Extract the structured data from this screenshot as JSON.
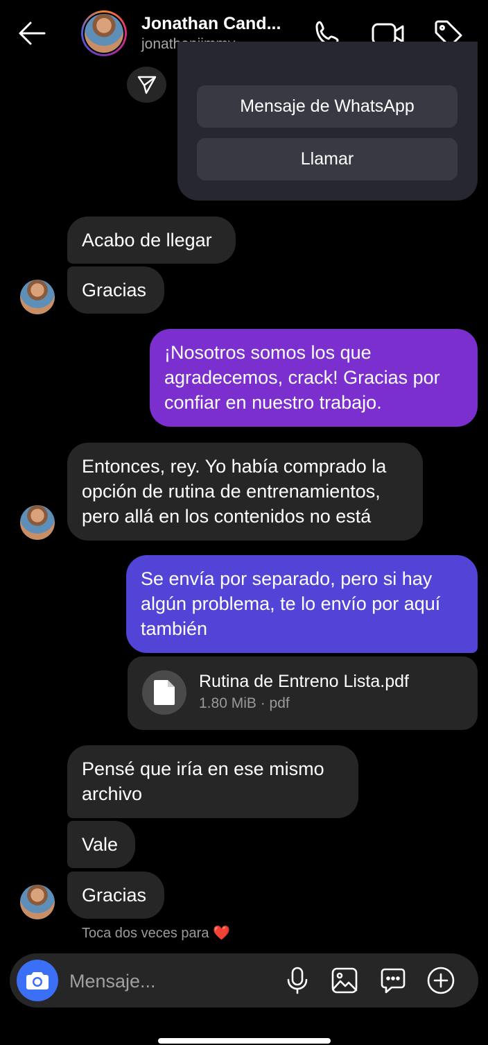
{
  "header": {
    "name": "Jonathan Cand...",
    "username": "jonathanjimmy_",
    "icons": [
      "back-arrow-icon",
      "phone-icon",
      "video-icon",
      "tag-icon"
    ]
  },
  "contact_card": {
    "whatsapp_label": "Mensaje de WhatsApp",
    "call_label": "Llamar",
    "share_icon": "send-icon"
  },
  "messages": [
    {
      "from": "them",
      "text": "Acabo de llegar"
    },
    {
      "from": "them",
      "text": "Gracias"
    },
    {
      "from": "me",
      "text": "¡Nosotros somos los que agradecemos, crack! Gracias por confiar en nuestro trabajo."
    },
    {
      "from": "them",
      "text": "Entonces, rey. Yo había comprado la opción de rutina de entrenamientos, pero allá en los contenidos no está"
    },
    {
      "from": "me",
      "text": "Se envía por separado, pero si hay algún problema, te lo envío por aquí también"
    },
    {
      "from": "them",
      "text": "Pensé que iría en ese mismo archivo"
    },
    {
      "from": "them",
      "text": "Vale"
    },
    {
      "from": "them",
      "text": "Gracias"
    }
  ],
  "file": {
    "name": "Rutina de Entreno Lista.pdf",
    "meta": "1.80 MiB · pdf",
    "icon": "file-icon"
  },
  "hint": {
    "text": "Toca dos veces para",
    "emoji": "❤️"
  },
  "composer": {
    "placeholder": "Mensaje...",
    "icons": [
      "camera-icon",
      "microphone-icon",
      "image-icon",
      "sticker-chat-icon",
      "plus-circle-icon"
    ]
  },
  "colors": {
    "background": "#000000",
    "incoming_bubble": "#262626",
    "outgoing_purple": "#7b2fcf",
    "outgoing_indigo": "#5244d6",
    "camera_button": "#3b6ff5",
    "heart": "#e0242c"
  }
}
